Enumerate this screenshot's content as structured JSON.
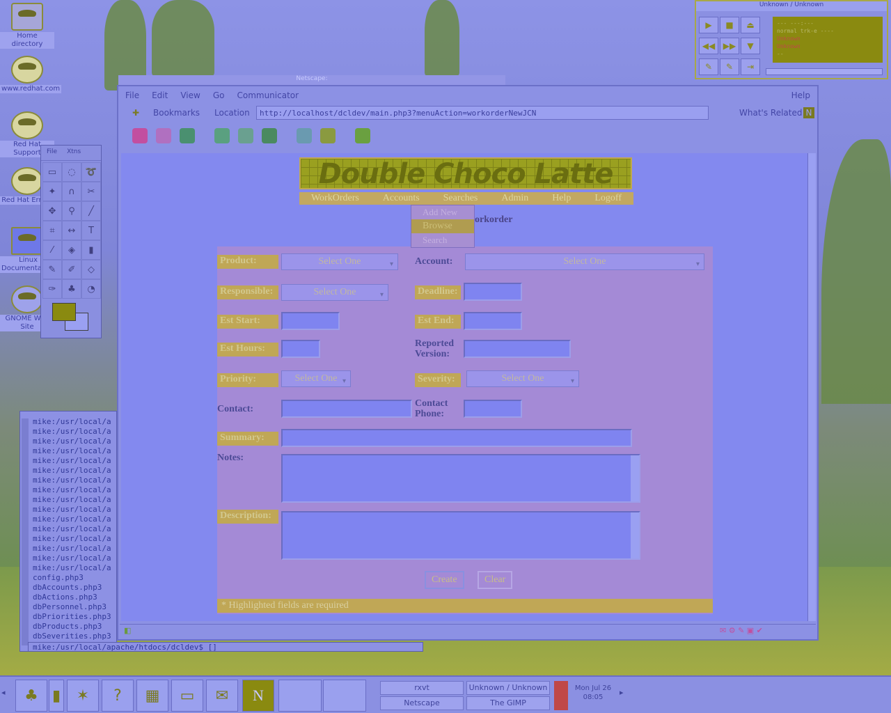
{
  "desktop": {
    "icons": [
      {
        "label": "Home directory"
      },
      {
        "label": "www.redhat.com"
      },
      {
        "label": "Red Hat Support"
      },
      {
        "label": "Red Hat Errata"
      },
      {
        "label": "Linux Documentation"
      },
      {
        "label": "GNOME Web Site"
      }
    ]
  },
  "gimp": {
    "menu": [
      "File",
      "Xtns"
    ]
  },
  "xmms": {
    "title": "Unknown / Unknown",
    "display_lines": [
      "---    ---:---",
      "normal  trk-e  ----",
      "Unknown",
      "Unknown",
      "--"
    ]
  },
  "netscape": {
    "window_title": "Netscape:",
    "menu": [
      "File",
      "Edit",
      "View",
      "Go",
      "Communicator"
    ],
    "help": "Help",
    "bookmarks": "Bookmarks",
    "location_label": "Location",
    "url": "http://localhost/dcldev/main.php3?menuAction=workorderNewJCN",
    "whats_related": "What's Related"
  },
  "page": {
    "banner": "Double Choco Latte",
    "nav": [
      "WorkOrders",
      "Accounts",
      "Searches",
      "Admin",
      "Help",
      "Logoff"
    ],
    "accounts_dropdown": [
      "Add New",
      "Browse",
      "Search"
    ],
    "heading_fragment": "orkorder",
    "form": {
      "product_label": "Product:",
      "product_value": "Select One",
      "account_label": "Account:",
      "account_value": "Select One",
      "responsible_label": "Responsible:",
      "responsible_value": "Select One",
      "deadline_label": "Deadline:",
      "est_start_label": "Est Start:",
      "est_end_label": "Est End:",
      "est_hours_label": "Est Hours:",
      "reported_version_label": "Reported Version:",
      "priority_label": "Priority:",
      "priority_value": "Select One",
      "severity_label": "Severity:",
      "severity_value": "Select One",
      "contact_label": "Contact:",
      "contact_phone_label": "Contact Phone:",
      "summary_label": "Summary:",
      "notes_label": "Notes:",
      "description_label": "Description:",
      "create": "Create",
      "clear": "Clear",
      "footnote": "* Highlighted fields are required"
    }
  },
  "terminal": {
    "lines": [
      "mike:/usr/local/a",
      "mike:/usr/local/a",
      "mike:/usr/local/a",
      "mike:/usr/local/a",
      "mike:/usr/local/a",
      "mike:/usr/local/a",
      "mike:/usr/local/a",
      "mike:/usr/local/a",
      "mike:/usr/local/a",
      "mike:/usr/local/a",
      "mike:/usr/local/a",
      "mike:/usr/local/a",
      "mike:/usr/local/a",
      "mike:/usr/local/a",
      "mike:/usr/local/a",
      "mike:/usr/local/a",
      "config.php3",
      "dbAccounts.php3",
      "dbActions.php3",
      "dbPersonnel.php3",
      "dbPriorities.php3",
      "dbProducts.php3",
      "dbSeverities.php3"
    ],
    "prompt": "mike:/usr/local/apache/htdocs/dcldev$ []"
  },
  "panel": {
    "tasks": [
      "rxvt",
      "Unknown / Unknown",
      "Netscape",
      "The GIMP"
    ],
    "clock_date": "Mon Jul 26",
    "clock_time": "08:05"
  },
  "colors": {
    "accent_required": "#c0a756",
    "form_bg": "#a48ad6"
  }
}
